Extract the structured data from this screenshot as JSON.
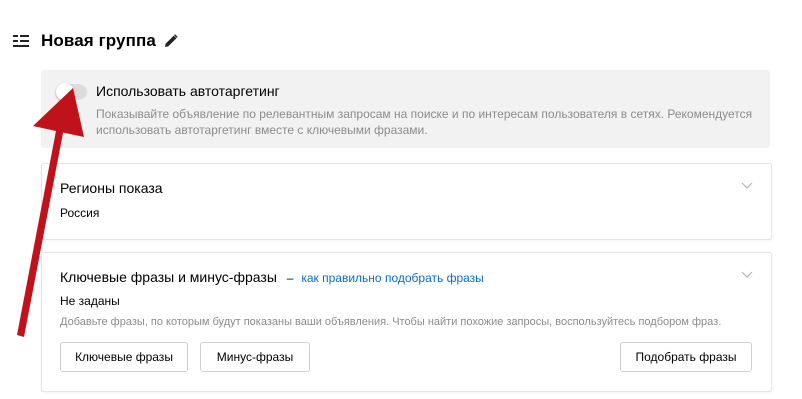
{
  "header": {
    "title": "Новая группа",
    "icons": {
      "list": "list-icon",
      "edit": "pencil-icon"
    }
  },
  "autotargeting": {
    "enabled": false,
    "label": "Использовать автотаргетинг",
    "description": "Показывайте объявление по релевантным запросам на поиске и по интересам пользователя в сетях. Рекомендуется использовать автотаргетинг вместе с ключевыми фразами."
  },
  "regions": {
    "title": "Регионы показа",
    "value": "Россия"
  },
  "phrases": {
    "title": "Ключевые фразы и минус-фразы",
    "separator": "–",
    "help_link": "как правильно подобрать фразы",
    "status": "Не заданы",
    "hint": "Добавьте фразы, по которым будут показаны ваши объявления. Чтобы найти похожие запросы, воспользуйтесь подбором фраз.",
    "buttons": {
      "keywords": "Ключевые фразы",
      "negative": "Минус-фразы",
      "pick": "Подобрать фразы"
    }
  },
  "colors": {
    "link": "#0b6ec5",
    "annotation_arrow": "#c0121b",
    "panel_bg": "#f2f2f2",
    "muted_text": "#8c8c8c"
  }
}
